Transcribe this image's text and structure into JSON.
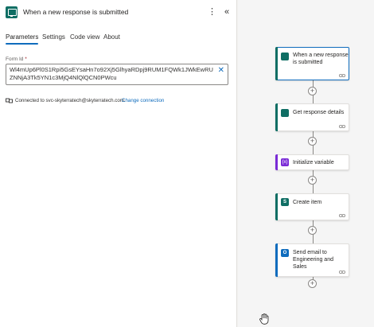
{
  "panel": {
    "title": "When a new response is submitted",
    "tabs": [
      {
        "label": "Parameters",
        "active": true
      },
      {
        "label": "Settings",
        "active": false
      },
      {
        "label": "Code view",
        "active": false
      },
      {
        "label": "About",
        "active": false
      }
    ],
    "form_id": {
      "label": "Form Id",
      "required_marker": "*",
      "value": "Wl4mUp6Pl0S1Rpi5GsEYsaHn7o92Xj5GlhyaRDpj9RUM1FQWk1JWkEwRUZNNjA3Tk5YN1c3MjQ4NlQlQCN0PWcu"
    },
    "connection": {
      "text": "Connected to svc-skyterratech@skyterratech.com.",
      "change_link": "Change connection"
    }
  },
  "flow": {
    "nodes": [
      {
        "label": "When a new response is submitted",
        "icon": "forms-icon",
        "color": "#0f6e64",
        "selected": true
      },
      {
        "label": "Get response details",
        "icon": "forms-icon",
        "color": "#0f6e64",
        "selected": false
      },
      {
        "label": "Initialize variable",
        "icon": "variable-icon",
        "color": "#7a2bd6",
        "selected": false
      },
      {
        "label": "Create item",
        "icon": "sharepoint-icon",
        "color": "#0f6e64",
        "selected": false
      },
      {
        "label": "Send email to Engineering and Sales",
        "icon": "outlook-icon",
        "color": "#0f6cbd",
        "selected": false
      }
    ]
  },
  "colors": {
    "accent": "#0f6cbd",
    "forms": "#0f6e64",
    "variable": "#7a2bd6"
  }
}
